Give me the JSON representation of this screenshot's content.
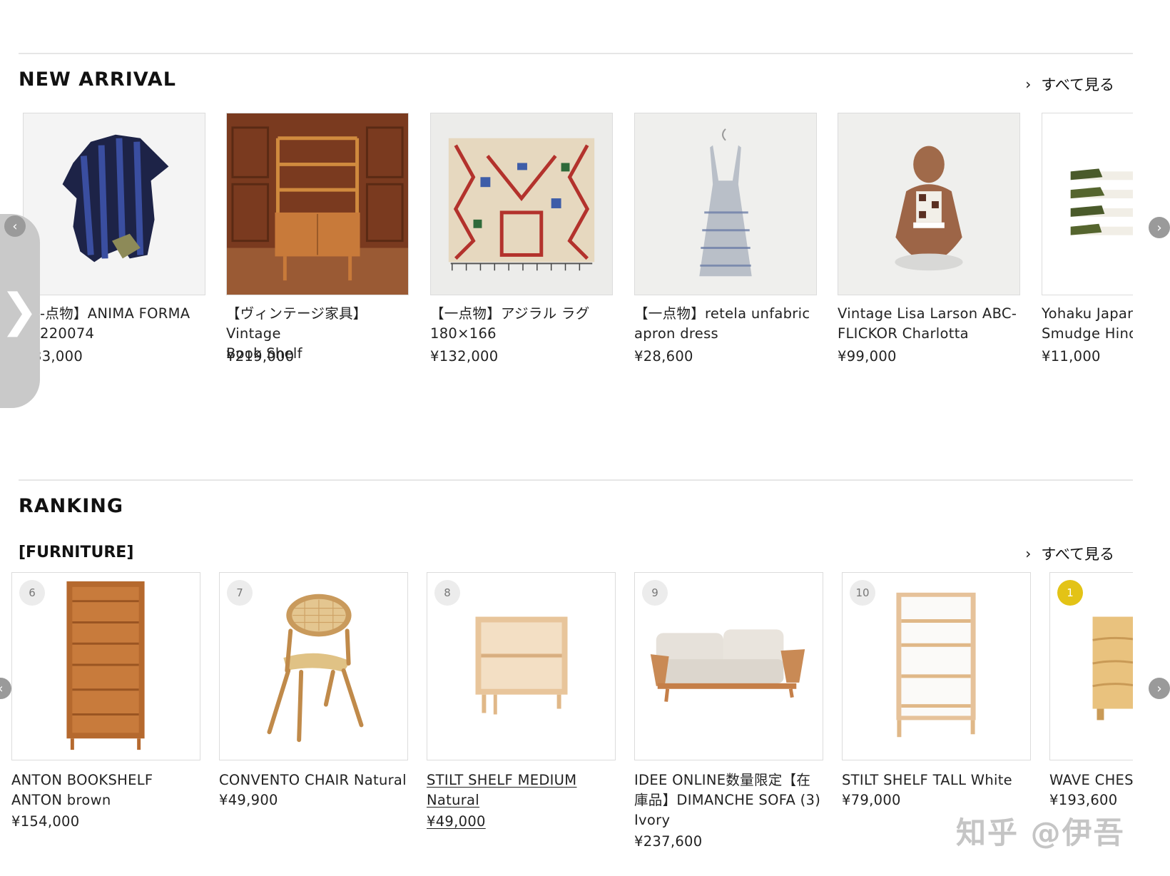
{
  "new_arrival": {
    "title": "NEW ARRIVAL",
    "see_all": "すべて見る",
    "items": [
      {
        "name": "【一点物】ANIMA FORMA 220074",
        "name_visible": "-点物】ANIMA FORMA",
        "line2": "220074",
        "price": "¥33,000",
        "price_visible": "33,000"
      },
      {
        "name": "【ヴィンテージ家具】Vintage Book Shelf",
        "line1": "【ヴィンテージ家具】Vintage",
        "line2": "Book Shelf",
        "price": "¥219,000"
      },
      {
        "name": "【一点物】アジラル ラグ 180×166",
        "line1": "【一点物】アジラル ラグ",
        "line2": "180×166",
        "price": "¥132,000"
      },
      {
        "name": "【一点物】retela unfabric apron dress",
        "line1": "【一点物】retela unfabric",
        "line2": "apron dress",
        "price": "¥28,600"
      },
      {
        "name": "Vintage Lisa Larson ABC-FLICKOR Charlotta",
        "line1": "Vintage Lisa Larson ABC-",
        "line2": "FLICKOR Charlotta",
        "price": "¥99,000"
      },
      {
        "name": "Yohaku Japan Smudge Hinoki",
        "line1": "Yohaku Japan",
        "line2": "Smudge Hinoki",
        "price": "¥11,000"
      }
    ]
  },
  "ranking": {
    "title": "RANKING",
    "category": "[FURNITURE]",
    "see_all": "すべて見る",
    "items": [
      {
        "rank": "6",
        "line1": "ANTON BOOKSHELF",
        "line2": "ANTON brown",
        "price": "¥154,000"
      },
      {
        "rank": "7",
        "line1": "CONVENTO CHAIR Natural",
        "price": "¥49,900"
      },
      {
        "rank": "8",
        "line1": "STILT SHELF MEDIUM",
        "line2": "Natural",
        "price": "¥49,000"
      },
      {
        "rank": "9",
        "line1": "IDEE ONLINE数量限定【在",
        "line2": "庫品】DIMANCHE SOFA (3)",
        "line3": "Ivory",
        "price": "¥237,600"
      },
      {
        "rank": "10",
        "line1": "STILT SHELF TALL White",
        "price": "¥79,000"
      },
      {
        "rank": "1",
        "line1": "WAVE CHEST",
        "price": "¥193,600"
      }
    ]
  },
  "arrows": {
    "prev": "‹",
    "next": "›",
    "side": "❯"
  },
  "watermark": "知乎 @伊吾",
  "colors": {
    "accent_gold": "#e3c316",
    "rule": "#e6e6e6",
    "text": "#222222"
  }
}
